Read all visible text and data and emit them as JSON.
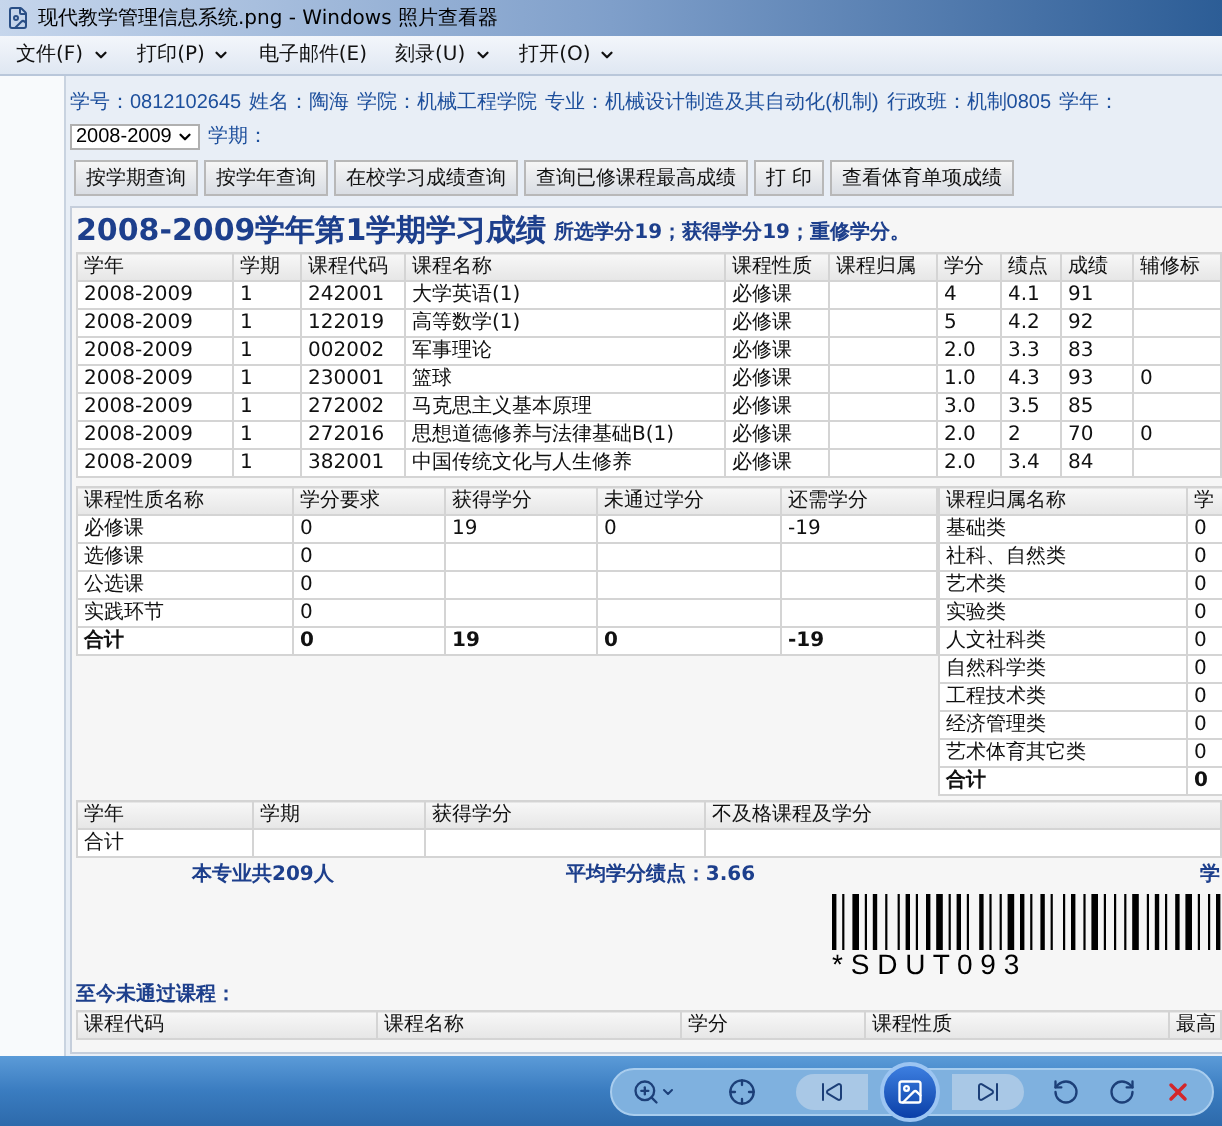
{
  "window": {
    "title": "现代教学管理信息系统.png - Windows 照片查看器"
  },
  "menu": [
    {
      "label": "文件(F)",
      "dropdown": true
    },
    {
      "label": "打印(P)",
      "dropdown": true
    },
    {
      "label": "电子邮件(E)",
      "dropdown": false
    },
    {
      "label": "刻录(U)",
      "dropdown": true
    },
    {
      "label": "打开(O)",
      "dropdown": true
    }
  ],
  "student_info": [
    "学号：0812102645",
    "姓名：陶海",
    "学院：机械工程学院",
    "专业：机械设计制造及其自动化(机制)",
    "行政班：机制0805"
  ],
  "year_select": {
    "label": "学年：",
    "value": "2008-2009"
  },
  "term_label": "学期：",
  "buttons": [
    "按学期查询",
    "按学年查询",
    "在校学习成绩查询",
    "查询已修课程最高成绩",
    "打 印",
    "查看体育单项成绩"
  ],
  "report": {
    "title": "2008-2009学年第1学期学习成绩",
    "summary": "所选学分19；获得学分19；重修学分。"
  },
  "grades": {
    "columns": [
      "学年",
      "学期",
      "课程代码",
      "课程名称",
      "课程性质",
      "课程归属",
      "学分",
      "绩点",
      "成绩",
      "辅修标"
    ],
    "rows": [
      [
        "2008-2009",
        "1",
        "242001",
        "大学英语(1)",
        "必修课",
        null,
        "4",
        "4.1",
        "91",
        null
      ],
      [
        "2008-2009",
        "1",
        "122019",
        "高等数学(1)",
        "必修课",
        null,
        "5",
        "4.2",
        "92",
        null
      ],
      [
        "2008-2009",
        "1",
        "002002",
        "军事理论",
        "必修课",
        null,
        "2.0",
        "3.3",
        "83",
        null
      ],
      [
        "2008-2009",
        "1",
        "230001",
        "篮球",
        "必修课",
        null,
        "1.0",
        "4.3",
        "93",
        "0"
      ],
      [
        "2008-2009",
        "1",
        "272002",
        "马克思主义基本原理",
        "必修课",
        null,
        "3.0",
        "3.5",
        "85",
        null
      ],
      [
        "2008-2009",
        "1",
        "272016",
        "思想道德修养与法律基础B(1)",
        "必修课",
        null,
        "2.0",
        "2",
        "70",
        "0"
      ],
      [
        "2008-2009",
        "1",
        "382001",
        "中国传统文化与人生修养",
        "必修课",
        null,
        "2.0",
        "3.4",
        "84",
        null
      ]
    ]
  },
  "credits_by_type": {
    "columns": [
      "课程性质名称",
      "学分要求",
      "获得学分",
      "未通过学分",
      "还需学分"
    ],
    "rows": [
      {
        "kind": "normal",
        "cells": [
          "必修课",
          "0",
          "19",
          "0",
          "-19"
        ]
      },
      {
        "kind": "normal",
        "cells": [
          "选修课",
          "0",
          null,
          null,
          null
        ]
      },
      {
        "kind": "normal",
        "cells": [
          "公选课",
          "0",
          null,
          null,
          null
        ]
      },
      {
        "kind": "normal",
        "cells": [
          "实践环节",
          "0",
          null,
          null,
          null
        ]
      },
      {
        "kind": "total",
        "cells": [
          "合计",
          "0",
          "19",
          "0",
          "-19"
        ]
      }
    ]
  },
  "credits_by_category": {
    "columns": [
      "课程归属名称",
      "学"
    ],
    "rows": [
      {
        "kind": "normal",
        "cells": [
          "基础类",
          "0"
        ]
      },
      {
        "kind": "normal",
        "cells": [
          "社科、自然类",
          "0"
        ]
      },
      {
        "kind": "normal",
        "cells": [
          "艺术类",
          "0"
        ]
      },
      {
        "kind": "normal",
        "cells": [
          "实验类",
          "0"
        ]
      },
      {
        "kind": "normal",
        "cells": [
          "人文社科类",
          "0"
        ]
      },
      {
        "kind": "normal",
        "cells": [
          "自然科学类",
          "0"
        ]
      },
      {
        "kind": "normal",
        "cells": [
          "工程技术类",
          "0"
        ]
      },
      {
        "kind": "normal",
        "cells": [
          "经济管理类",
          "0"
        ]
      },
      {
        "kind": "normal",
        "cells": [
          "艺术体育其它类",
          "0"
        ]
      },
      {
        "kind": "total",
        "cells": [
          "合计",
          "0"
        ]
      }
    ]
  },
  "failed_by_term": {
    "columns": [
      "学年",
      "学期",
      "获得学分",
      "不及格课程及学分"
    ],
    "rows": [
      [
        "合计",
        null,
        null,
        null
      ]
    ]
  },
  "stats": [
    "本专业共209人",
    "平均学分绩点：3.66",
    "学"
  ],
  "barcode": {
    "text": "* S D U T 0 9 3"
  },
  "unpassed": {
    "title": "至今未通过课程：",
    "columns": [
      "课程代码",
      "课程名称",
      "学分",
      "课程性质",
      "最高"
    ]
  }
}
